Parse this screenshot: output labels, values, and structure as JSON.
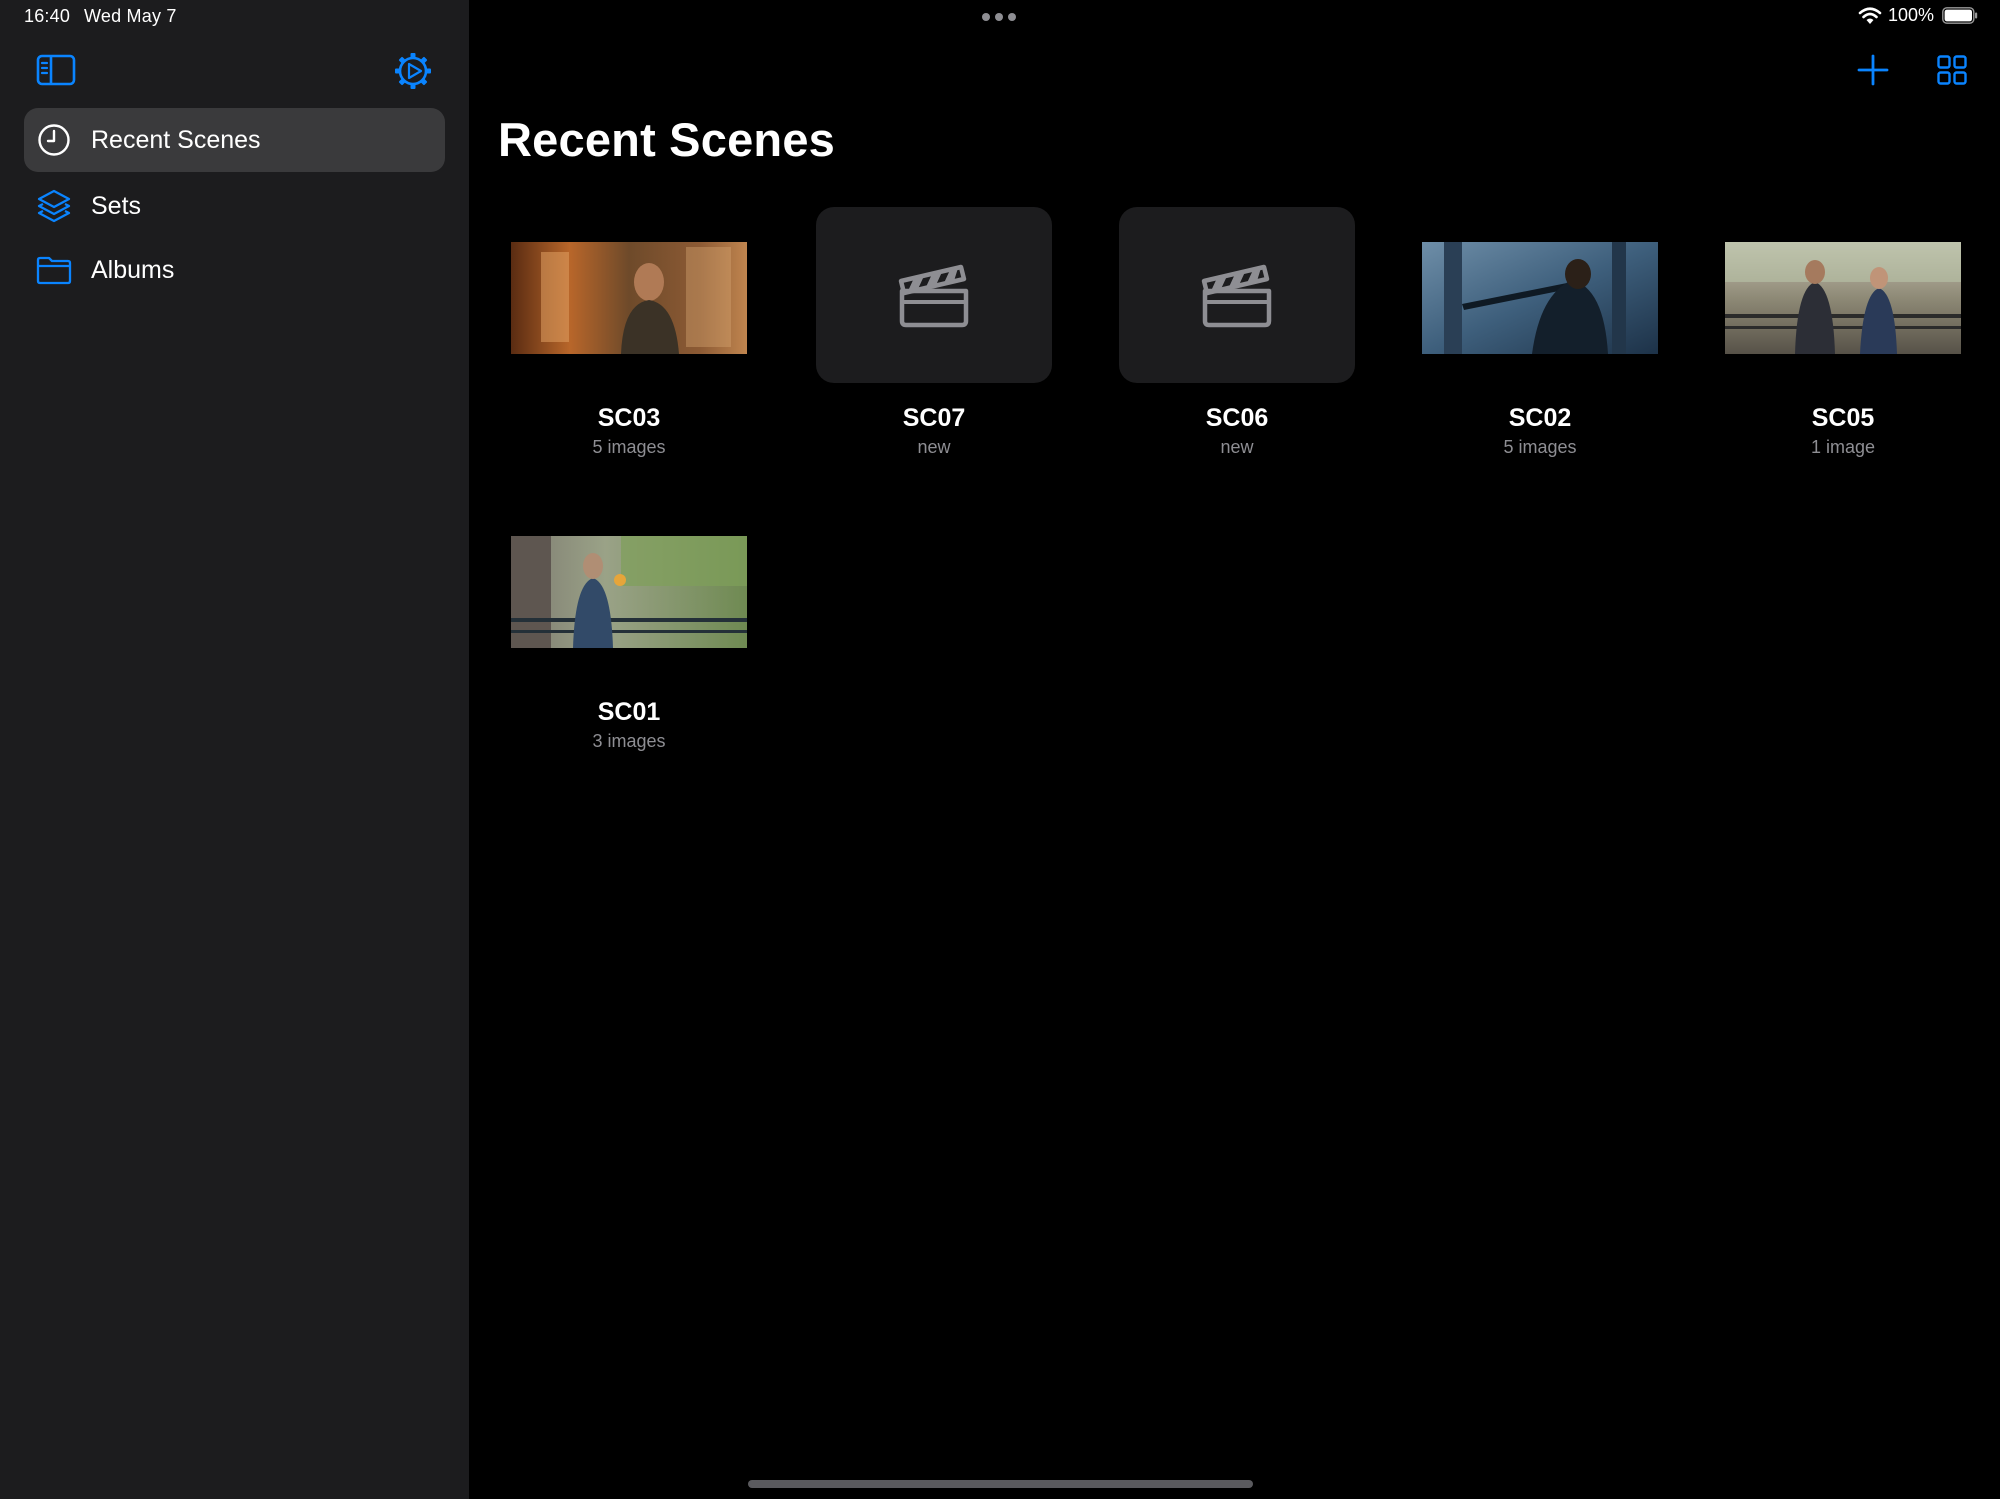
{
  "status_bar": {
    "time": "16:40",
    "date": "Wed May 7",
    "battery": "100%"
  },
  "colors": {
    "accent": "#0a84ff",
    "sidebar_bg": "#1c1c1e",
    "selected_bg": "#3a3a3c",
    "secondary_text": "#8e8e93"
  },
  "sidebar": {
    "items": [
      {
        "label": "Recent Scenes",
        "icon": "clock-icon",
        "selected": true
      },
      {
        "label": "Sets",
        "icon": "layers-icon",
        "selected": false
      },
      {
        "label": "Albums",
        "icon": "folder-icon",
        "selected": false
      }
    ]
  },
  "main": {
    "title": "Recent Scenes"
  },
  "scenes": [
    {
      "name": "SC03",
      "subtitle": "5 images",
      "thumbnail": "photo"
    },
    {
      "name": "SC07",
      "subtitle": "new",
      "thumbnail": "clapperboard-icon"
    },
    {
      "name": "SC06",
      "subtitle": "new",
      "thumbnail": "clapperboard-icon"
    },
    {
      "name": "SC02",
      "subtitle": "5 images",
      "thumbnail": "photo"
    },
    {
      "name": "SC05",
      "subtitle": "1 image",
      "thumbnail": "photo"
    },
    {
      "name": "SC01",
      "subtitle": "3 images",
      "thumbnail": "photo"
    }
  ]
}
